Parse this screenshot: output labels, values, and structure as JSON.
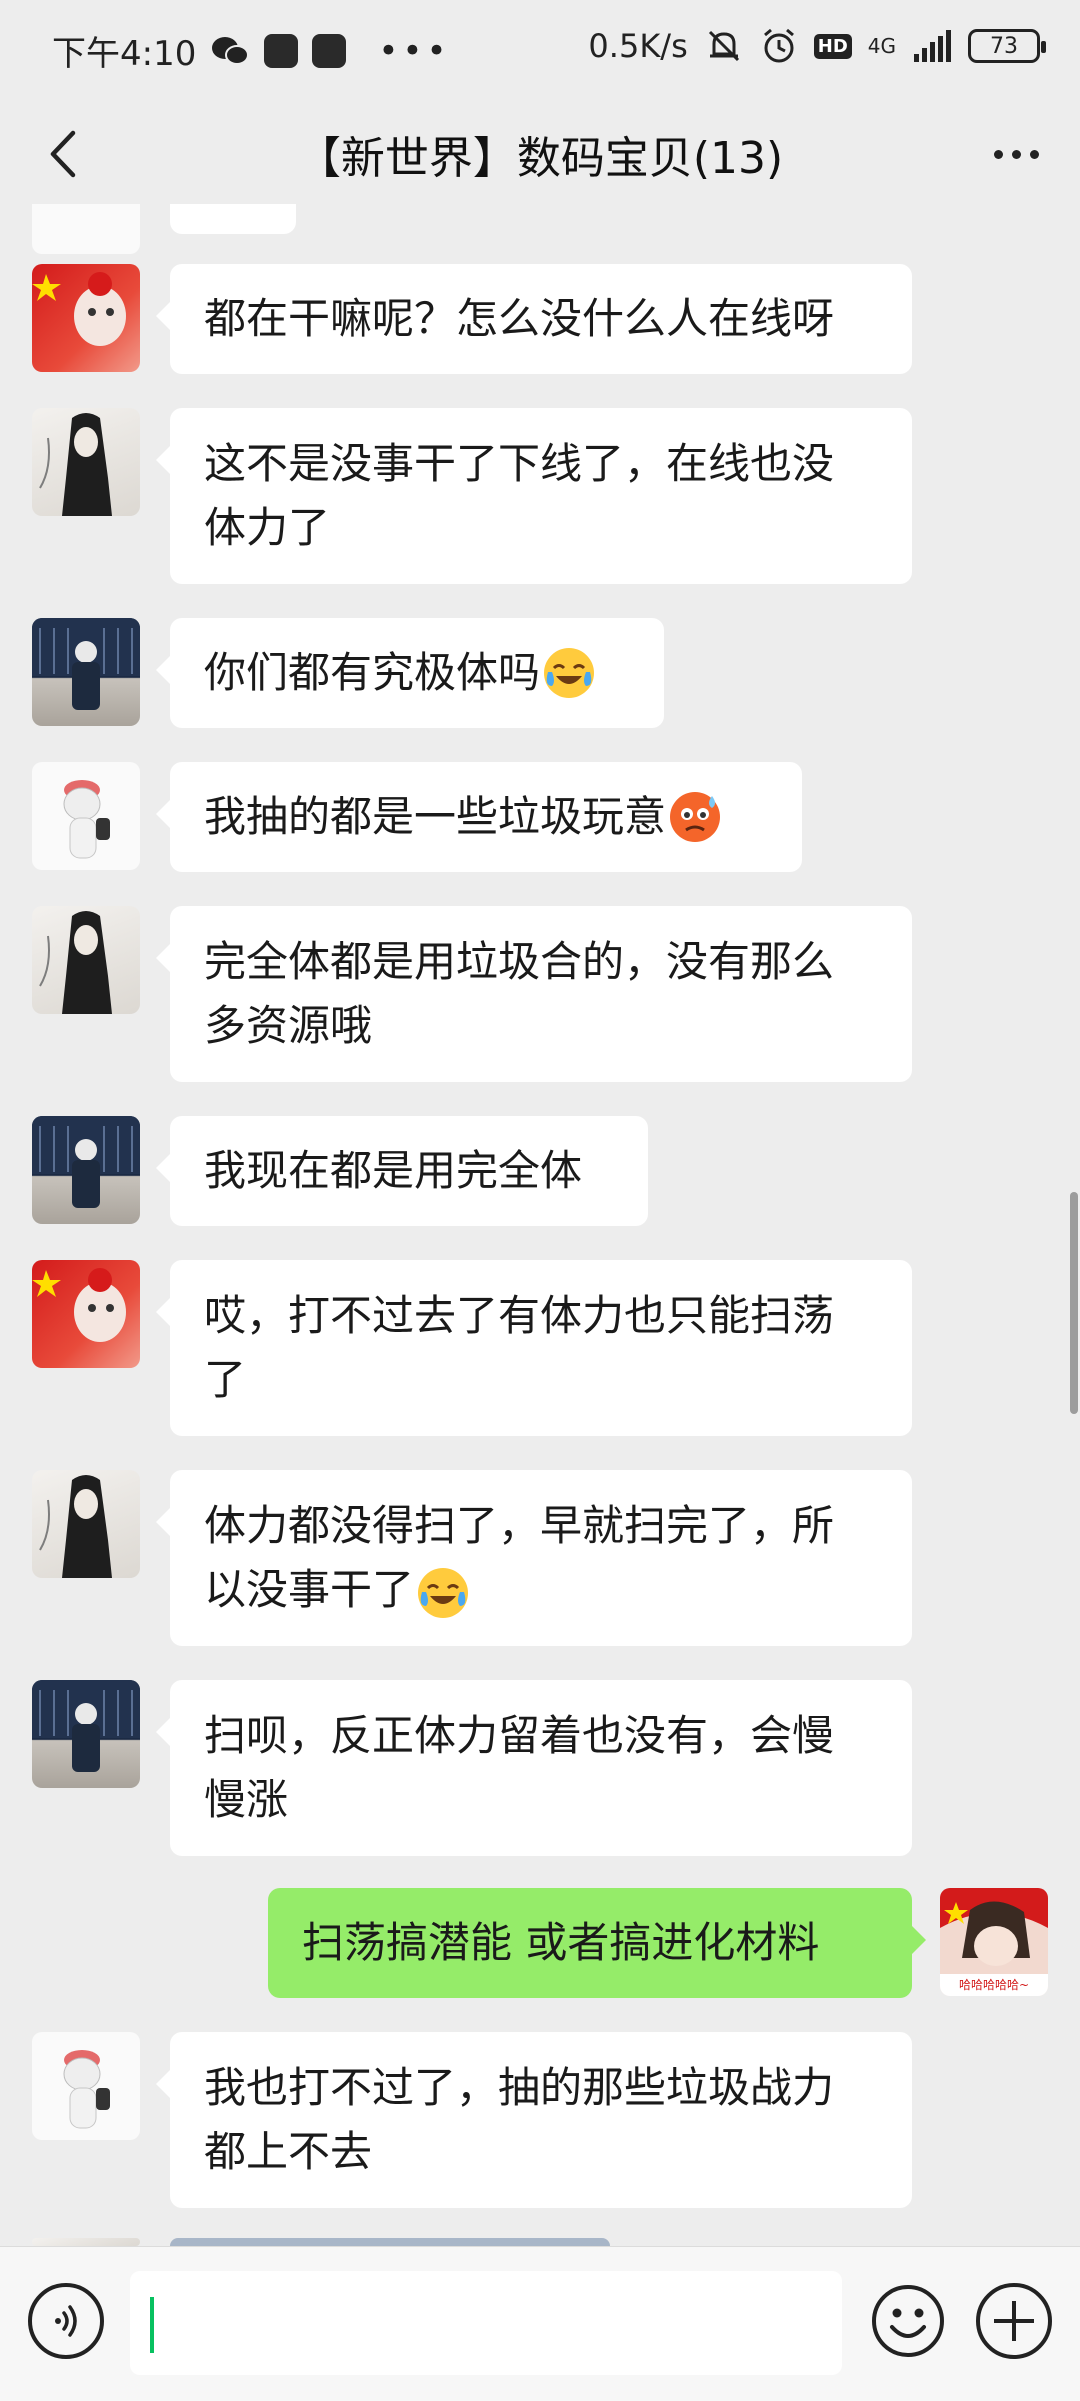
{
  "status_bar": {
    "time": "下午4:10",
    "speed": "0.5K/s",
    "network": "4G",
    "hd": "HD",
    "battery": "73"
  },
  "header": {
    "title": "【新世界】数码宝贝(13)"
  },
  "messages": [
    {
      "sender_avatar": "red-flag-avatar",
      "text": "都在干嘛呢？怎么没什么人在线呀"
    },
    {
      "sender_avatar": "sketch-girl-avatar",
      "lines": [
        "这不是没事干了下线了，在线也没",
        "体力了"
      ]
    },
    {
      "sender_avatar": "blue-photo-avatar",
      "text": "你们都有究极体吗",
      "emoji": "crying-laughing-emoji"
    },
    {
      "sender_avatar": "cat-avatar",
      "text": "我抽的都是一些垃圾玩意",
      "emoji": "cold-sweat-emoji"
    },
    {
      "sender_avatar": "sketch-girl-avatar",
      "lines": [
        "完全体都是用垃圾合的，没有那么",
        "多资源哦"
      ]
    },
    {
      "sender_avatar": "blue-photo-avatar",
      "text": "我现在都是用完全体"
    },
    {
      "sender_avatar": "red-flag-avatar",
      "lines": [
        "哎，打不过去了有体力也只能扫荡",
        "了"
      ]
    },
    {
      "sender_avatar": "sketch-girl-avatar",
      "lines": [
        "体力都没得扫了，早就扫完了，所",
        "以没事干了"
      ],
      "emoji": "crying-laughing-emoji"
    },
    {
      "sender_avatar": "blue-photo-avatar",
      "lines": [
        "扫呗，反正体力留着也没有，会慢",
        "慢涨"
      ]
    },
    {
      "sender_avatar": "self-avatar",
      "mine": true,
      "text": "扫荡搞潜能  或者搞进化材料",
      "avatar_caption": "哈哈哈哈哈~"
    },
    {
      "sender_avatar": "cat-avatar",
      "lines": [
        "我也打不过了，抽的那些垃圾战力",
        "都上不去"
      ]
    }
  ],
  "input": {
    "value": ""
  },
  "icons": {
    "back": "back-arrow-icon",
    "more": "more-dots-icon",
    "voice": "voice-icon",
    "emoji": "emoji-icon",
    "plus": "plus-icon"
  }
}
